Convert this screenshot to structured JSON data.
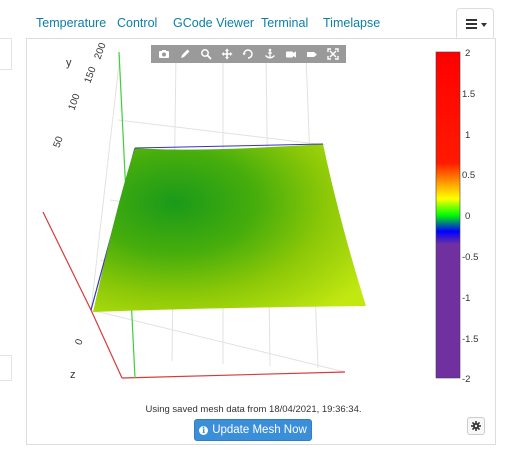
{
  "tabs": [
    {
      "label": "Temperature"
    },
    {
      "label": "Control"
    },
    {
      "label": "GCode Viewer"
    },
    {
      "label": "Terminal"
    },
    {
      "label": "Timelapse"
    }
  ],
  "plot": {
    "axis_labels": {
      "y": "y",
      "z": "z"
    },
    "y_ticks": [
      "200",
      "150",
      "100",
      "50",
      "0"
    ],
    "colorbar": {
      "range": [
        -2,
        2
      ],
      "tick_labels": [
        "2",
        "1.5",
        "1",
        "0.5",
        "0",
        "-0.5",
        "-1",
        "-1.5",
        "-2"
      ],
      "colors": {
        "top": "#ff0000",
        "yellow": "#ffff00",
        "green": "#00ff00",
        "blue": "#0000ff",
        "purple": "#7030a0"
      }
    },
    "toolbar_icons": [
      "camera-icon",
      "pencil-icon",
      "zoom-icon",
      "pan-icon",
      "orbit-icon",
      "turntable-icon",
      "reset-camera-icon",
      "hover-icon",
      "autoscale-icon"
    ]
  },
  "status": {
    "text": "Using saved mesh data from 18/04/2021, 19:36:34."
  },
  "actions": {
    "update_label": "Update Mesh Now"
  },
  "colors": {
    "accent": "#3b8fd9",
    "tab_link": "#0a7fa8"
  }
}
